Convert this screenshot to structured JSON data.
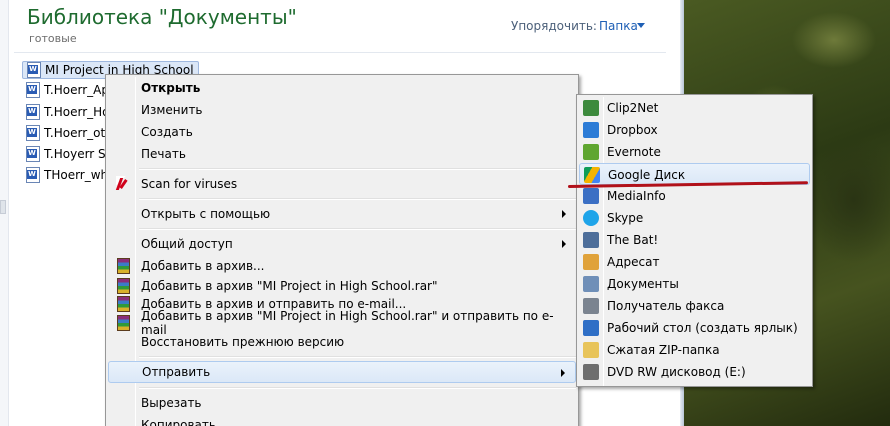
{
  "library": {
    "title": "Библиотека \"Документы\"",
    "status": "готовые",
    "arrange_label": "Упорядочить:",
    "arrange_value": "Папка"
  },
  "files": [
    {
      "name": "MI Project in High School",
      "selected": true
    },
    {
      "name": "T.Hoerr_Ap"
    },
    {
      "name": "T.Hoerr_Ho"
    },
    {
      "name": "T.Hoerr_ot"
    },
    {
      "name": "T.Hoyerr Sc"
    },
    {
      "name": "THoerr_wh"
    }
  ],
  "context_menu": {
    "items": [
      {
        "label": "Открыть",
        "bold": true
      },
      {
        "label": "Изменить"
      },
      {
        "label": "Создать"
      },
      {
        "label": "Печать"
      },
      {
        "label": "Scan for viruses",
        "icon": "kaspersky-icon"
      },
      {
        "label": "Открыть с помощью",
        "submenu": true
      },
      {
        "label": "Общий доступ",
        "submenu": true
      },
      {
        "label": "Добавить в архив...",
        "icon": "winrar-icon"
      },
      {
        "label": "Добавить в архив \"MI Project in High School.rar\"",
        "icon": "winrar-icon"
      },
      {
        "label": "Добавить в архив и отправить по e-mail...",
        "icon": "winrar-icon"
      },
      {
        "label": "Добавить в архив \"MI Project in High School.rar\" и отправить по e-mail",
        "icon": "winrar-icon"
      },
      {
        "label": "Восстановить прежнюю версию"
      },
      {
        "label": "Отправить",
        "submenu": true,
        "highlighted": true
      },
      {
        "label": "Вырезать"
      },
      {
        "label": "Копировать"
      }
    ]
  },
  "send_to_menu": {
    "items": [
      {
        "label": "Clip2Net",
        "icon": "clip2net-icon",
        "color": "#3d8a3d"
      },
      {
        "label": "Dropbox",
        "icon": "dropbox-icon",
        "color": "#2b7bd6"
      },
      {
        "label": "Evernote",
        "icon": "evernote-icon",
        "color": "#5fa630"
      },
      {
        "label": "Google Диск",
        "icon": "google-drive-icon",
        "color": "#f4b400",
        "highlighted": true
      },
      {
        "label": "MediaInfo",
        "icon": "mediainfo-icon",
        "color": "#3b6fc4"
      },
      {
        "label": "Skype",
        "icon": "skype-icon",
        "color": "#1ea4e9"
      },
      {
        "label": "The Bat!",
        "icon": "thebat-icon",
        "color": "#4d6e9a"
      },
      {
        "label": "Адресат",
        "icon": "mail-recipient-icon",
        "color": "#e0a23a"
      },
      {
        "label": "Документы",
        "icon": "documents-icon",
        "color": "#6f8fb8"
      },
      {
        "label": "Получатель факса",
        "icon": "fax-icon",
        "color": "#7b8490"
      },
      {
        "label": "Рабочий стол (создать ярлык)",
        "icon": "desktop-icon",
        "color": "#2f6fc6"
      },
      {
        "label": "Сжатая ZIP-папка",
        "icon": "zip-folder-icon",
        "color": "#e8c45a"
      },
      {
        "label": "DVD RW дисковод (E:)",
        "icon": "dvd-drive-icon",
        "color": "#6e6e6e"
      }
    ]
  }
}
